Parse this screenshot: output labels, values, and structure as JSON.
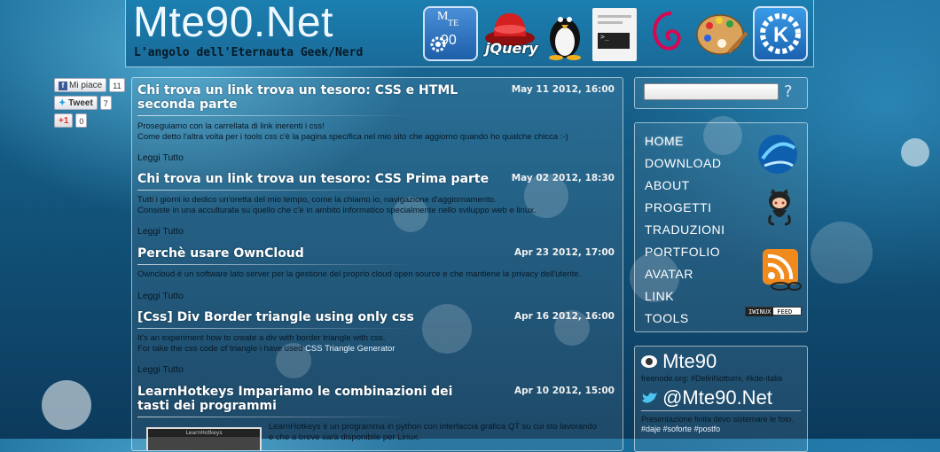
{
  "header": {
    "title": "Mte90.Net",
    "subtitle": "L'angolo dell'Eternauta Geek/Nerd",
    "logo_badge": {
      "line1": "M",
      "line2": "TE",
      "line3": "90"
    },
    "icons": [
      {
        "name": "mte90-logo-icon",
        "color": "#1d5fa8"
      },
      {
        "name": "jquery-logo-icon",
        "label": "jQuery",
        "color": "#cc1e1e"
      },
      {
        "name": "tux-linux-icon",
        "color": "#111111"
      },
      {
        "name": "terminal-icon",
        "color": "#f3f3f3"
      },
      {
        "name": "debian-swirl-icon",
        "color": "#d70751"
      },
      {
        "name": "paint-palette-icon",
        "color": "#d9a35b"
      },
      {
        "name": "kde-logo-icon",
        "color": "#1a72c7"
      }
    ]
  },
  "social": {
    "facebook": {
      "label": "Mi piace",
      "count": "11"
    },
    "twitter": {
      "label": "Tweet",
      "count": "7"
    },
    "google": {
      "label": "+1",
      "count": "0"
    }
  },
  "posts": [
    {
      "title": "Chi trova un link trova un tesoro: CSS e HTML seconda parte",
      "date": "May 11 2012, 16:00",
      "body": [
        "Proseguiamo con la carrellata di link inerenti i css!",
        "Come detto l'altra volta per i tools css c'è la pagina specifica nel mio sito che aggiorno quando ho qualche chicca :-)"
      ],
      "more": "Leggi Tutto"
    },
    {
      "title": "Chi trova un link trova un tesoro: CSS Prima parte",
      "date": "May 02 2012, 18:30",
      "body": [
        "Tutti i giorni io dedico un'oretta del mio tempo, come la chiamo io, navigazione d'aggiornamento.",
        "Consiste in una acculturata su quello che c'è in ambito informatico specialmente nello sviluppo web e linux."
      ],
      "more": "Leggi Tutto"
    },
    {
      "title": "Perchè usare OwnCloud",
      "date": "Apr 23 2012, 17:00",
      "body": [
        "Owncloud è un software lato server per la gestione del proprio cloud open source e che mantiene la privacy dell'utente."
      ],
      "more": "Leggi Tutto"
    },
    {
      "title": "[Css] Div Border triangle using only css",
      "date": "Apr 16 2012, 16:00",
      "body": [
        "It's an experiment how to create a div with border triangle with css.",
        "For take the css code of triangle i have used "
      ],
      "link": "CSS Triangle Generator",
      "more": "Leggi Tutto"
    },
    {
      "title": "LearnHotkeys Impariamo le combinazioni dei tasti dei programmi",
      "date": "Apr 10 2012, 15:00",
      "body": [
        "LearnHotkeys è un programma in python con interfaccia grafica QT su cui sto lavorando",
        "e che a breve sarà disponibile per Linux."
      ],
      "thumb_title": "LearnHotkeys"
    }
  ],
  "search": {
    "placeholder": "",
    "help": "?"
  },
  "nav": {
    "items": [
      "HOME",
      "DOWNLOAD",
      "ABOUT",
      "PROGETTI",
      "TRADUZIONI",
      "PORTFOLIO",
      "AVATAR",
      "LINK",
      "TOOLS"
    ],
    "active": "HOME",
    "badge": {
      "left": "IWINUX",
      "right": "FEED"
    }
  },
  "irc": {
    "name": "Mte90",
    "channels": "freenode.org: #DeliriNotturni, #kde-italia"
  },
  "twitter": {
    "handle": "@Mte90.Net",
    "text": "Presentazione finita devo sistemare le foto.",
    "tags": [
      "#daje",
      "#soforte",
      "#postfo"
    ]
  }
}
